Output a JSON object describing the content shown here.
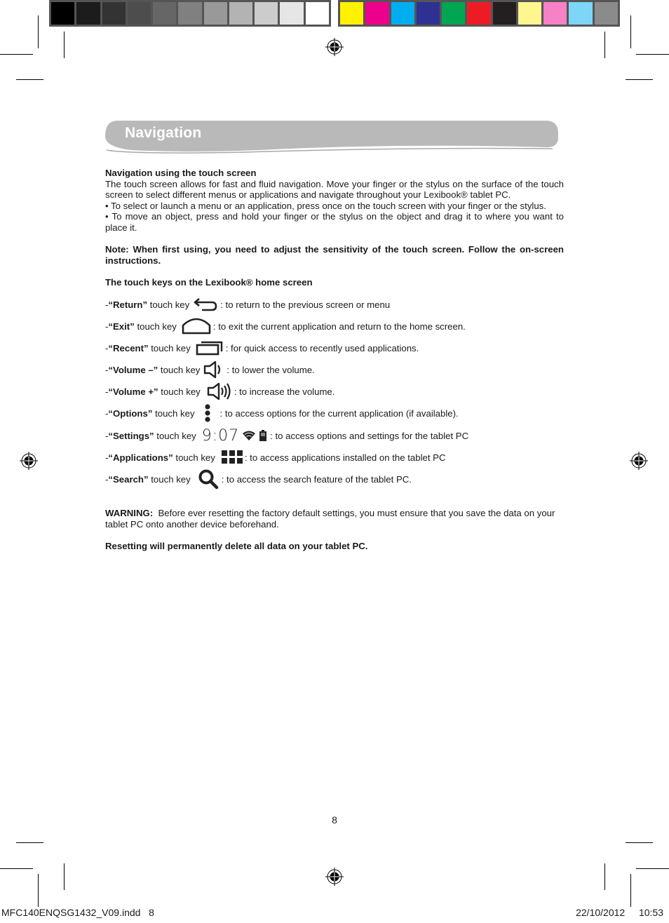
{
  "color_bars": {
    "grayscale": [
      "#000000",
      "#1c1c1c",
      "#333333",
      "#4d4d4d",
      "#666666",
      "#808080",
      "#999999",
      "#b3b3b3",
      "#cccccc",
      "#e6e6e6",
      "#ffffff"
    ],
    "process": [
      "#fff200",
      "#ec008c",
      "#00aeef",
      "#2e3192",
      "#00a651",
      "#ed1c24",
      "#231f20",
      "#fff68f",
      "#f681c6",
      "#7dd6f8",
      "#8b8b8b"
    ]
  },
  "section": {
    "title": "Navigation",
    "banner_color": "#b9b9b9"
  },
  "intro": {
    "heading": "Navigation using the touch screen",
    "paragraph": "The touch screen allows for fast and fluid navigation. Move your finger or the stylus on the surface of the touch screen to select different menus or applications and navigate throughout your Lexibook® tablet PC.",
    "bullets": [
      "• To select or launch a menu or an application, press once on the touch screen with your finger or the stylus.",
      "• To move an object, press and hold your finger or the stylus on the object and drag it to where you want to place it."
    ]
  },
  "note": "Note: When first using, you need to adjust the sensitivity of the touch screen. Follow the on-screen instructions.",
  "touch_keys": {
    "heading": "The touch keys on the Lexibook® home screen",
    "prefix": "- ",
    "touch_key_label": "touch key",
    "items": [
      {
        "name": "“Return”",
        "icon": "return-arrow-icon",
        "description": ": to return to the previous screen or menu"
      },
      {
        "name": "“Exit”",
        "icon": "home-icon",
        "description": ": to exit the current application and return to the home screen."
      },
      {
        "name": "“Recent”",
        "icon": "recent-apps-icon",
        "description": ": for quick access to recently used applications."
      },
      {
        "name": "“Volume –”",
        "icon": "volume-down-icon",
        "description": ": to lower the volume."
      },
      {
        "name": "“Volume +”",
        "icon": "volume-up-icon",
        "description": ": to increase the volume."
      },
      {
        "name": "“Options”",
        "icon": "options-menu-icon",
        "description": ": to access options for the current application (if available)."
      },
      {
        "name": "“Settings”",
        "icon": "status-clock-icon",
        "clock_text": "9:07",
        "description": ": to access options and settings for the tablet PC"
      },
      {
        "name": "“Applications”",
        "icon": "apps-grid-icon",
        "description": ": to access applications installed on the tablet PC"
      },
      {
        "name": "“Search”",
        "icon": "search-icon",
        "description": ": to access the search feature of the tablet PC."
      }
    ]
  },
  "warning": {
    "label": "WARNING:",
    "text": "  Before ever resetting the factory default settings, you must ensure that you save the data on your tablet PC onto another device beforehand.",
    "final": "Resetting will permanently delete all data on your tablet PC."
  },
  "page_number": "8",
  "slug": {
    "file": "MFC140ENQSG1432_V09.indd   8",
    "datetime": "22/10/2012  10:53"
  }
}
